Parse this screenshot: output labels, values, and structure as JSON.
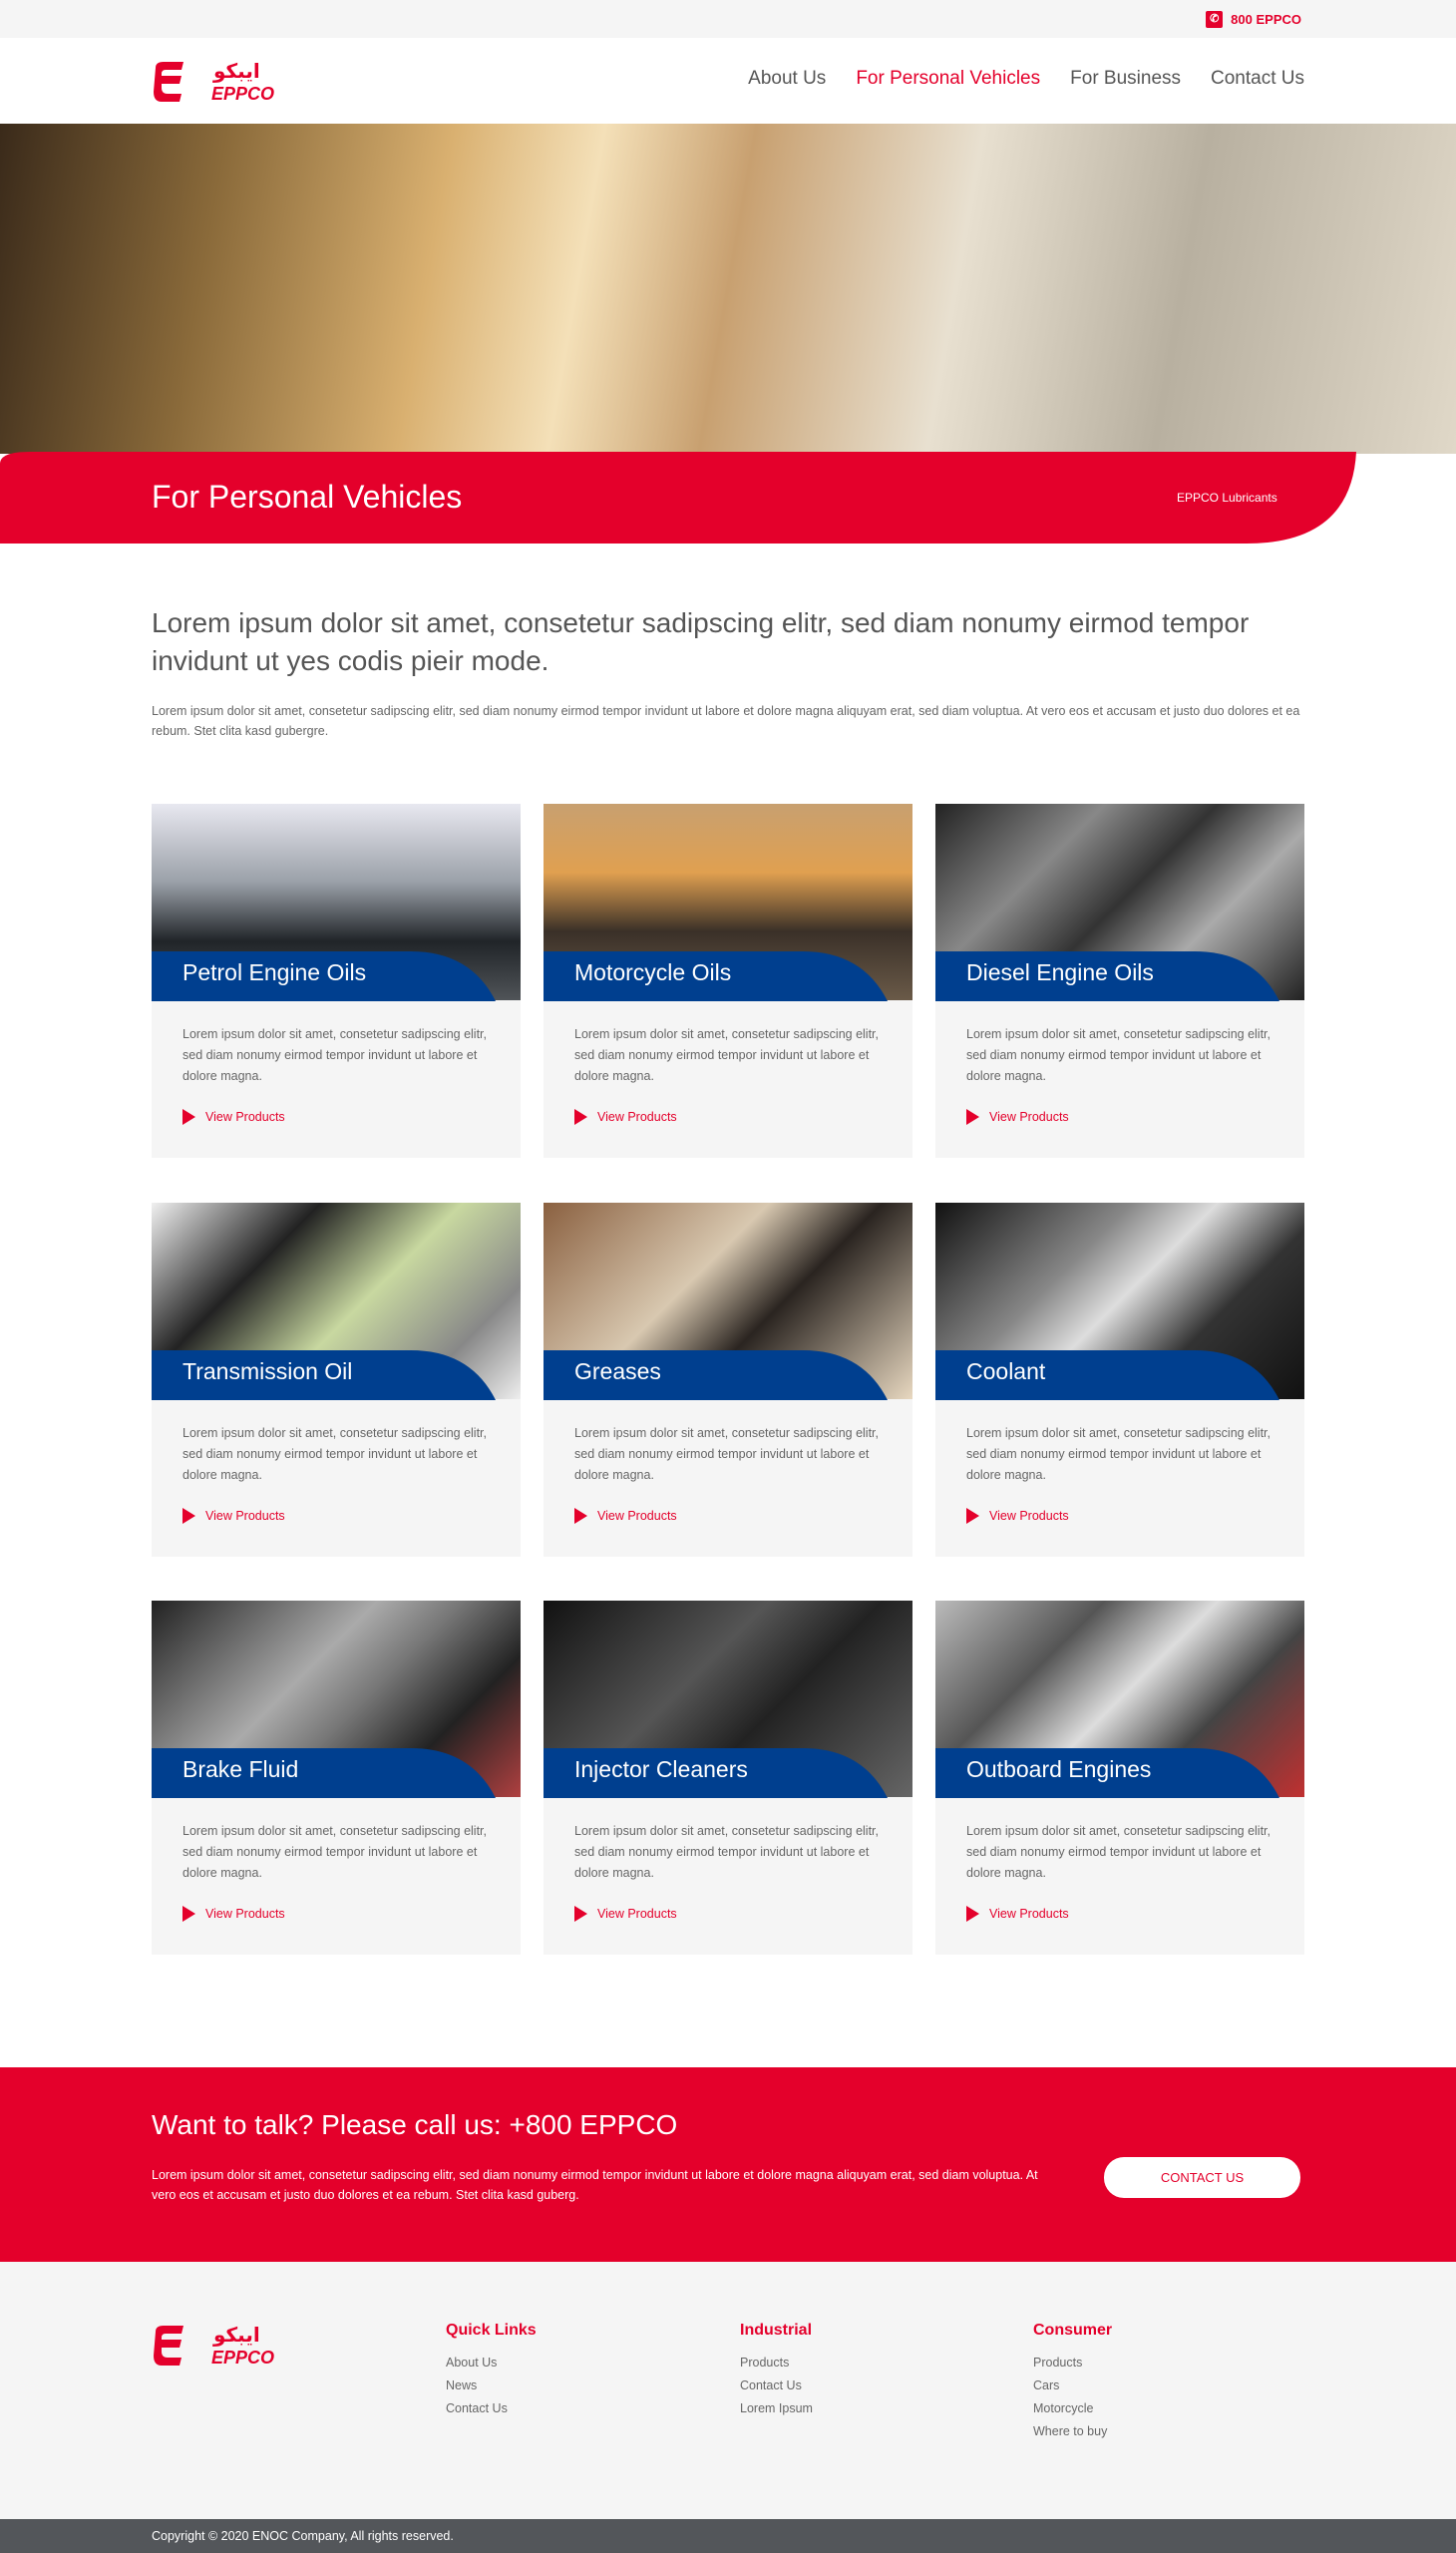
{
  "brand": {
    "logo_arabic": "ايبكو",
    "logo_latin": "EPPCO",
    "red": "#e4002b",
    "blue": "#003f8f"
  },
  "topbar": {
    "phone_icon": "phone-icon",
    "phone": "800 EPPCO"
  },
  "nav": {
    "items": [
      "About Us",
      "For Personal Vehicles",
      "For Business",
      "Contact Us"
    ],
    "active": "For Personal Vehicles"
  },
  "banner": {
    "title": "For Personal Vehicles",
    "breadcrumb": "EPPCO Lubricants"
  },
  "intro": {
    "heading": "Lorem ipsum dolor sit amet, consetetur sadipscing elitr, sed diam nonumy eirmod tempor invidunt ut yes codis pieir mode.",
    "text": "Lorem ipsum dolor sit amet, consetetur sadipscing elitr, sed diam nonumy eirmod tempor invidunt ut labore et dolore magna aliquyam erat, sed diam voluptua. At vero eos et accusam et justo duo dolores et ea rebum. Stet clita kasd gubergre."
  },
  "cards": [
    {
      "title": "Petrol Engine Oils",
      "text": "Lorem ipsum dolor sit amet, consetetur sadipscing elitr, sed diam nonumy eirmod tempor invidunt ut labore et dolore magna.",
      "link": "View Products"
    },
    {
      "title": "Motorcycle Oils",
      "text": "Lorem ipsum dolor sit amet, consetetur sadipscing elitr, sed diam nonumy eirmod tempor invidunt ut labore et dolore magna.",
      "link": "View Products"
    },
    {
      "title": "Diesel Engine Oils",
      "text": "Lorem ipsum dolor sit amet, consetetur sadipscing elitr, sed diam nonumy eirmod tempor invidunt ut labore et dolore magna.",
      "link": "View Products"
    },
    {
      "title": "Transmission Oil",
      "text": "Lorem ipsum dolor sit amet, consetetur sadipscing elitr, sed diam nonumy eirmod tempor invidunt ut labore et dolore magna.",
      "link": "View Products"
    },
    {
      "title": "Greases",
      "text": "Lorem ipsum dolor sit amet, consetetur sadipscing elitr, sed diam nonumy eirmod tempor invidunt ut labore et dolore magna.",
      "link": "View Products"
    },
    {
      "title": "Coolant",
      "text": "Lorem ipsum dolor sit amet, consetetur sadipscing elitr, sed diam nonumy eirmod tempor invidunt ut labore et dolore magna.",
      "link": "View Products"
    },
    {
      "title": "Brake Fluid",
      "text": "Lorem ipsum dolor sit amet, consetetur sadipscing elitr, sed diam nonumy eirmod tempor invidunt ut labore et dolore magna.",
      "link": "View Products"
    },
    {
      "title": "Injector Cleaners",
      "text": "Lorem ipsum dolor sit amet, consetetur sadipscing elitr, sed diam nonumy eirmod tempor invidunt ut labore et dolore magna.",
      "link": "View Products"
    },
    {
      "title": "Outboard Engines",
      "text": "Lorem ipsum dolor sit amet, consetetur sadipscing elitr, sed diam nonumy eirmod tempor invidunt ut labore et dolore magna.",
      "link": "View Products"
    }
  ],
  "cta": {
    "heading": "Want to talk? Please call us: +800 EPPCO",
    "text": "Lorem ipsum dolor sit amet, consetetur sadipscing elitr, sed diam nonumy eirmod tempor invidunt ut labore et dolore magna aliquyam erat, sed diam voluptua. At vero eos et accusam et justo duo dolores et ea rebum. Stet clita kasd guberg.",
    "button": "CONTACT US"
  },
  "footer": {
    "columns": [
      {
        "title": "Quick Links",
        "links": [
          "About Us",
          "News",
          "Contact Us"
        ]
      },
      {
        "title": "Industrial",
        "links": [
          "Products",
          "Contact Us",
          "Lorem Ipsum"
        ]
      },
      {
        "title": "Consumer",
        "links": [
          "Products",
          "Cars",
          "Motorcycle",
          "Where to buy"
        ]
      }
    ],
    "copyright": "Copyright © 2020 ENOC Company, All rights reserved."
  }
}
